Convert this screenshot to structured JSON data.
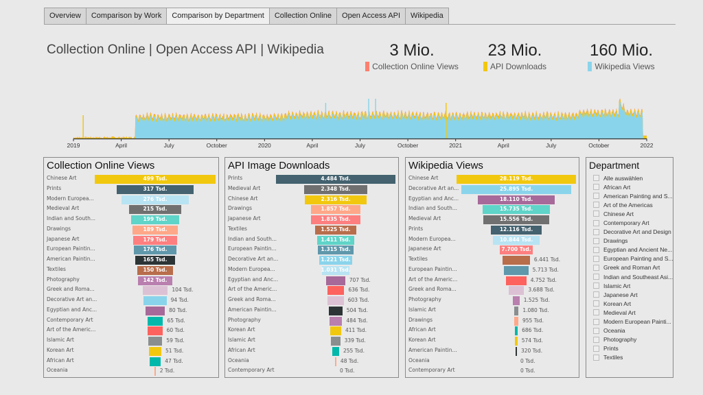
{
  "tabs": [
    {
      "label": "Overview",
      "active": false
    },
    {
      "label": "Comparison by Work",
      "active": false
    },
    {
      "label": "Comparison by Department",
      "active": true
    },
    {
      "label": "Collection Online",
      "active": false
    },
    {
      "label": "Open Access API",
      "active": false
    },
    {
      "label": "Wikipedia",
      "active": false
    }
  ],
  "header": {
    "title": "Collection Online | Open Access API | Wikipedia"
  },
  "kpis": [
    {
      "value": "3 Mio.",
      "label": "Collection Online Views",
      "color": "#fd7f6f"
    },
    {
      "value": "23 Mio.",
      "label": "API Downloads",
      "color": "#f2c80f"
    },
    {
      "value": "160 Mio.",
      "label": "Wikipedia Views",
      "color": "#8ad4eb"
    }
  ],
  "colors": {
    "Chinese Art": "#f2c80f",
    "Prints": "#44626f",
    "Modern European Painting": "#b8e3f2",
    "Medieval Art": "#707070",
    "Indian and Southeast Asian Art": "#5fd4c8",
    "Drawings": "#fea889",
    "Japanese Art": "#fd7f7f",
    "European Painting": "#5f97ab",
    "American Painting": "#2d3436",
    "Textiles": "#b86d4b",
    "Photography": "#b97fae",
    "Greek and Roman Art": "#dcc1d4",
    "Decorative Art": "#8ad4eb",
    "Egyptian and Ancient Near East": "#a66999",
    "Contemporary Art": "#01b8aa",
    "Art of the Americas": "#fd625e",
    "Islamic Art": "#8a8e8e",
    "Korean Art": "#f2c80f",
    "African Art": "#01b8aa",
    "Oceania": "#fea889"
  },
  "timeline": {
    "x_ticks": [
      "2019",
      "April",
      "July",
      "October",
      "2020",
      "April",
      "July",
      "October",
      "2021",
      "April",
      "July",
      "October",
      "2022"
    ],
    "legend": [
      "Collection Online Views",
      "API Downloads",
      "Wikipedia Views"
    ]
  },
  "chart_data": [
    {
      "type": "bar",
      "title": "Collection Online Views",
      "unit": "Tsd.",
      "categories": [
        "Chinese Art",
        "Prints",
        "Modern Europea...",
        "Medieval Art",
        "Indian and South...",
        "Drawings",
        "Japanese Art",
        "European Paintin...",
        "American Paintin...",
        "Textiles",
        "Photography",
        "Greek and Roma...",
        "Decorative Art an...",
        "Egyptian and Anc...",
        "Contemporary Art",
        "Art of the Americ...",
        "Islamic Art",
        "Korean Art",
        "African Art",
        "Oceania"
      ],
      "color_keys": [
        "Chinese Art",
        "Prints",
        "Modern European Painting",
        "Medieval Art",
        "Indian and Southeast Asian Art",
        "Drawings",
        "Japanese Art",
        "European Painting",
        "American Painting",
        "Textiles",
        "Photography",
        "Greek and Roman Art",
        "Decorative Art",
        "Egyptian and Ancient Near East",
        "Contemporary Art",
        "Art of the Americas",
        "Islamic Art",
        "Korean Art",
        "African Art",
        "Oceania"
      ],
      "values": [
        499,
        317,
        276,
        215,
        199,
        189,
        179,
        176,
        165,
        150,
        142,
        104,
        94,
        80,
        65,
        60,
        59,
        51,
        47,
        2
      ],
      "labels": [
        "499 Tsd.",
        "317 Tsd.",
        "276 Tsd.",
        "215 Tsd.",
        "199 Tsd.",
        "189 Tsd.",
        "179 Tsd.",
        "176 Tsd.",
        "165 Tsd.",
        "150 Tsd.",
        "142 Tsd.",
        "104 Tsd.",
        "94 Tsd.",
        "80 Tsd.",
        "65 Tsd.",
        "60 Tsd.",
        "59 Tsd.",
        "51 Tsd.",
        "47 Tsd.",
        "2 Tsd."
      ]
    },
    {
      "type": "bar",
      "title": "API Image Downloads",
      "unit": "Tsd.",
      "categories": [
        "Prints",
        "Medieval Art",
        "Chinese Art",
        "Drawings",
        "Japanese Art",
        "Textiles",
        "Indian and South...",
        "European Paintin...",
        "Decorative Art an...",
        "Modern Europea...",
        "Egyptian and Anc...",
        "Art of the Americ...",
        "Greek and Roma...",
        "American Paintin...",
        "Photography",
        "Korean Art",
        "Islamic Art",
        "African Art",
        "Oceania",
        "Contemporary Art"
      ],
      "color_keys": [
        "Prints",
        "Medieval Art",
        "Chinese Art",
        "Drawings",
        "Japanese Art",
        "Textiles",
        "Indian and Southeast Asian Art",
        "European Painting",
        "Decorative Art",
        "Modern European Painting",
        "Egyptian and Ancient Near East",
        "Art of the Americas",
        "Greek and Roman Art",
        "American Painting",
        "Photography",
        "Korean Art",
        "Islamic Art",
        "African Art",
        "Oceania",
        "Contemporary Art"
      ],
      "values": [
        4484,
        2348,
        2316,
        1857,
        1835,
        1525,
        1411,
        1315,
        1221,
        1031,
        707,
        636,
        603,
        504,
        484,
        411,
        339,
        255,
        48,
        0
      ],
      "labels": [
        "4.484 Tsd.",
        "2.348 Tsd.",
        "2.316 Tsd.",
        "1.857 Tsd.",
        "1.835 Tsd.",
        "1.525 Tsd.",
        "1.411 Tsd.",
        "1.315 Tsd.",
        "1.221 Tsd.",
        "1.031 Tsd.",
        "707 Tsd.",
        "636 Tsd.",
        "603 Tsd.",
        "504 Tsd.",
        "484 Tsd.",
        "411 Tsd.",
        "339 Tsd.",
        "255 Tsd.",
        "48 Tsd.",
        "0 Tsd."
      ]
    },
    {
      "type": "bar",
      "title": "Wikipedia Views",
      "unit": "Tsd.",
      "categories": [
        "Chinese Art",
        "Decorative Art an...",
        "Egyptian and Anc...",
        "Indian and South...",
        "Medieval Art",
        "Prints",
        "Modern Europea...",
        "Japanese Art",
        "Textiles",
        "European Paintin...",
        "Art of the Americ...",
        "Greek and Roma...",
        "Photography",
        "Islamic Art",
        "Drawings",
        "African Art",
        "Korean Art",
        "American Paintin...",
        "Oceania",
        "Contemporary Art"
      ],
      "color_keys": [
        "Chinese Art",
        "Decorative Art",
        "Egyptian and Ancient Near East",
        "Indian and Southeast Asian Art",
        "Medieval Art",
        "Prints",
        "Modern European Painting",
        "Japanese Art",
        "Textiles",
        "European Painting",
        "Art of the Americas",
        "Greek and Roman Art",
        "Photography",
        "Islamic Art",
        "Drawings",
        "African Art",
        "Korean Art",
        "American Painting",
        "Oceania",
        "Contemporary Art"
      ],
      "values": [
        28119,
        25895,
        18110,
        15735,
        15556,
        12116,
        10844,
        7700,
        6441,
        5713,
        4752,
        3688,
        1525,
        1080,
        955,
        686,
        574,
        320,
        0,
        0
      ],
      "labels": [
        "28.119 Tsd.",
        "25.895 Tsd.",
        "18.110 Tsd.",
        "15.735 Tsd.",
        "15.556 Tsd.",
        "12.116 Tsd.",
        "10.844 Tsd.",
        "7.700 Tsd.",
        "6.441 Tsd.",
        "5.713 Tsd.",
        "4.752 Tsd.",
        "3.688 Tsd.",
        "1.525 Tsd.",
        "1.080 Tsd.",
        "955 Tsd.",
        "686 Tsd.",
        "574 Tsd.",
        "320 Tsd.",
        "0 Tsd.",
        "0 Tsd."
      ]
    }
  ],
  "slicer": {
    "title": "Department",
    "items": [
      "Alle auswählen",
      "African Art",
      "American Painting and S...",
      "Art of the Americas",
      "Chinese Art",
      "Contemporary Art",
      "Decorative Art and Design",
      "Drawings",
      "Egyptian and Ancient Ne...",
      "European Painting and S...",
      "Greek and Roman Art",
      "Indian and Southeast Asi...",
      "Islamic Art",
      "Japanese Art",
      "Korean Art",
      "Medieval Art",
      "Modern European Painti...",
      "Oceania",
      "Photography",
      "Prints",
      "Textiles"
    ]
  }
}
